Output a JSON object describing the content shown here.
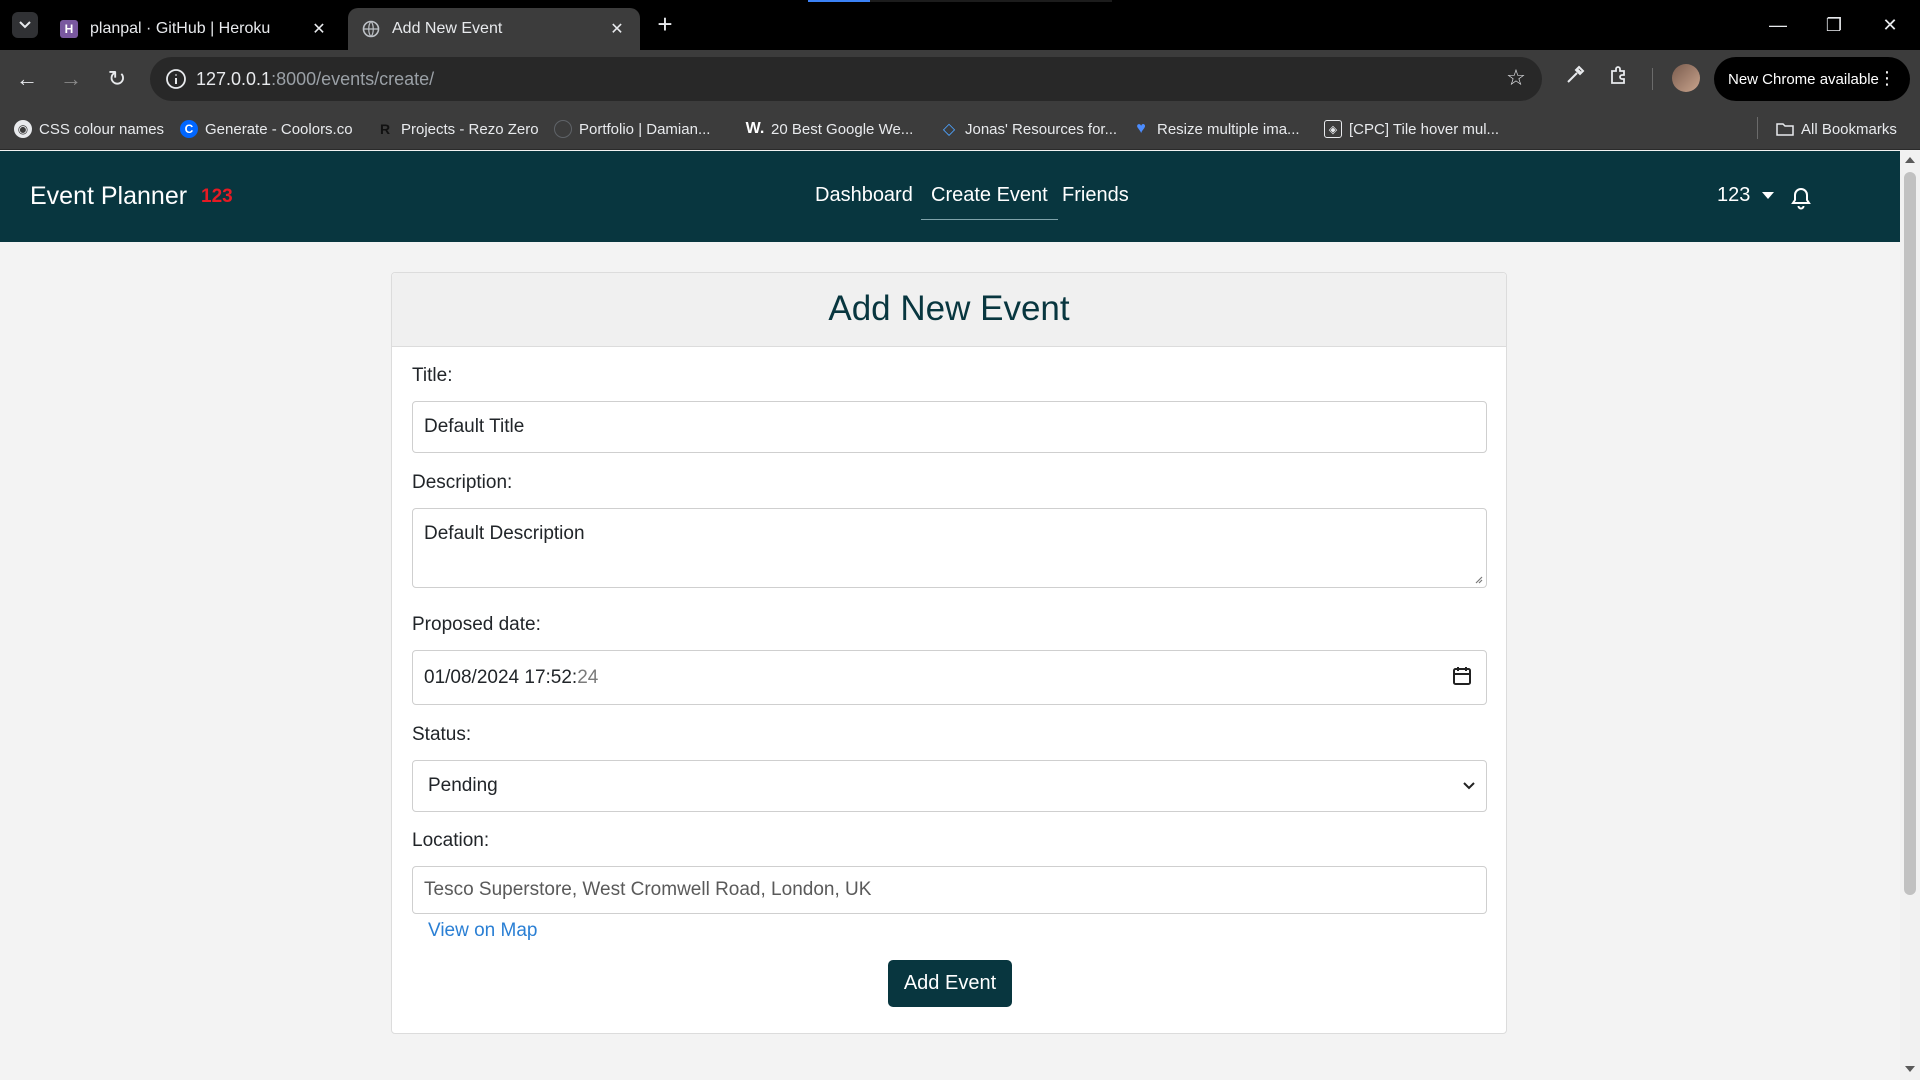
{
  "browser": {
    "tabs": [
      {
        "title": "planpal · GitHub | Heroku",
        "active": false
      },
      {
        "title": "Add New Event",
        "active": true
      }
    ],
    "new_tab_label": "+",
    "url_host": "127.0.0.1",
    "url_path": ":8000/events/create/",
    "update_button": "New Chrome available",
    "bookmarks": [
      "CSS colour names",
      "Generate - Coolors.co",
      "Projects - Rezo Zero",
      "Portfolio | Damian...",
      "20 Best Google We...",
      "Jonas' Resources for...",
      "Resize multiple ima...",
      "[CPC] Tile hover mul..."
    ],
    "all_bookmarks": "All Bookmarks"
  },
  "navbar": {
    "brand": "Event Planner",
    "badge": "123",
    "links": [
      "Dashboard",
      "Create Event",
      "Friends"
    ],
    "active_link": "Create Event",
    "user": "123"
  },
  "form": {
    "heading": "Add New Event",
    "title_label": "Title:",
    "title_value": "Default Title",
    "description_label": "Description:",
    "description_value": "Default Description",
    "date_label": "Proposed date:",
    "date_value": "01/08/2024  17:52:",
    "date_seconds": "24",
    "status_label": "Status:",
    "status_value": "Pending",
    "location_label": "Location:",
    "location_value": "Tesco Superstore, West Cromwell Road, London, UK",
    "map_link": "View on Map",
    "submit": "Add Event"
  },
  "colors": {
    "navbar_bg": "#08363f",
    "badge": "#e51b24",
    "link": "#2a7fd4",
    "button_bg": "#08363f"
  }
}
